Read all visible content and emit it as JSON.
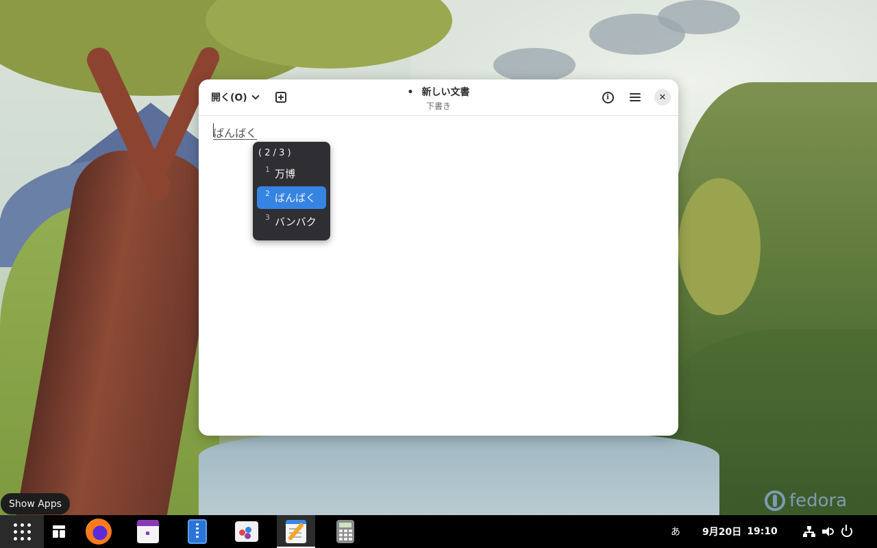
{
  "window": {
    "open_button_label": "開く(O)",
    "title_dot": "•",
    "title": "新しい文書",
    "subtitle": "下書き",
    "close_glyph": "✕",
    "info_glyph": "i"
  },
  "editor": {
    "preedit_text": "ばんばく"
  },
  "ime": {
    "page_indicator": "( 2 / 3 )",
    "candidates": [
      {
        "number": "1",
        "text": "万博",
        "selected": false
      },
      {
        "number": "2",
        "text": "ばんばく",
        "selected": true
      },
      {
        "number": "3",
        "text": "バンバク",
        "selected": false
      }
    ]
  },
  "tooltip": {
    "text": "Show Apps"
  },
  "dash": {
    "apps": [
      {
        "name": "activities-overview",
        "icon": "window-overview-icon"
      },
      {
        "name": "firefox",
        "icon": "firefox-icon"
      },
      {
        "name": "calendar",
        "icon": "calendar-icon"
      },
      {
        "name": "file-roller",
        "icon": "archive-icon"
      },
      {
        "name": "software",
        "icon": "software-store-icon"
      },
      {
        "name": "text-editor",
        "icon": "text-editor-icon",
        "active": true
      },
      {
        "name": "calculator",
        "icon": "calculator-icon"
      }
    ]
  },
  "topbar": {
    "input_method": "あ",
    "date": "9月20日",
    "time": "19:10"
  },
  "wallpaper": {
    "brand": "fedora"
  },
  "colors": {
    "accent": "#3584e4",
    "popup_bg": "#2f2f33",
    "dash_bg": "#000000"
  }
}
